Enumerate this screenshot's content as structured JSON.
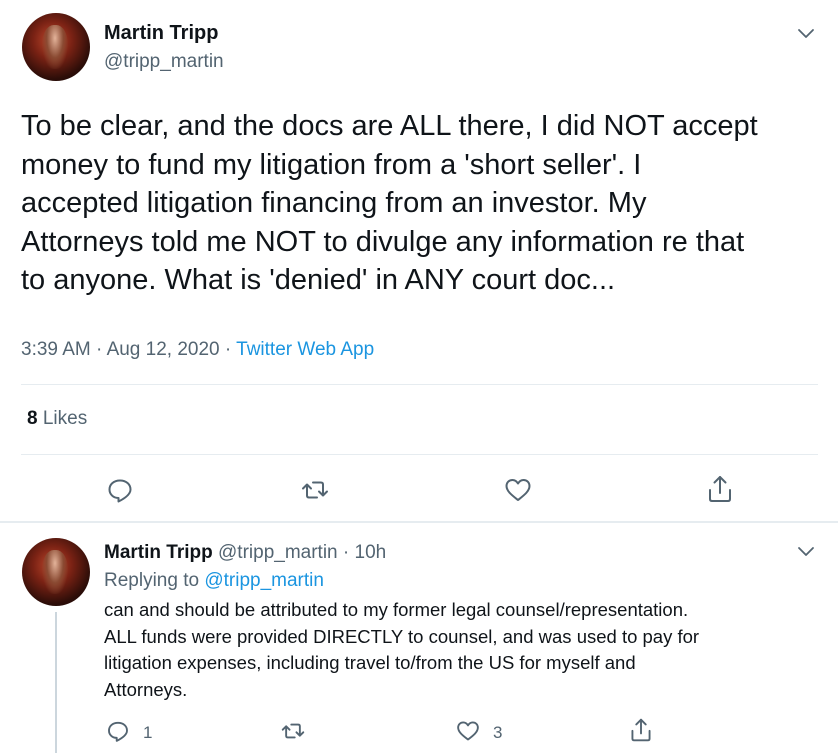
{
  "main_tweet": {
    "author_name": "Martin Tripp",
    "author_handle": "@tripp_martin",
    "text_lines": [
      "To be clear, and the docs are ALL there, I did NOT accept",
      "money to fund my litigation from a 'short seller'.  I",
      "accepted litigation financing from an investor.  My",
      "Attorneys told me NOT to divulge any information re that",
      "to anyone.  What is 'denied' in ANY court doc..."
    ],
    "time": "3:39 AM",
    "date": "Aug 12, 2020",
    "separator": "·",
    "source": "Twitter Web App",
    "likes_count": "8",
    "likes_label": "Likes"
  },
  "reply_tweet": {
    "author_name": "Martin Tripp",
    "author_handle": "@tripp_martin",
    "separator": "·",
    "time_ago": "10h",
    "replying_prefix": "Replying to",
    "replying_to": "@tripp_martin",
    "text_lines": [
      "can and should be attributed to my former legal counsel/representation.",
      "ALL funds were provided DIRECTLY to counsel, and was used to pay for",
      "litigation expenses, including travel to/from the US for myself and",
      "Attorneys."
    ],
    "reply_count": "1",
    "like_count": "3"
  },
  "icons": {
    "reply": "reply-icon",
    "retweet": "retweet-icon",
    "like": "heart-icon",
    "share": "share-icon",
    "menu": "chevron-down-icon"
  },
  "colors": {
    "text": "#0f1419",
    "secondary": "#536471",
    "link": "#1b95e0",
    "divider": "#e6ecf0"
  }
}
